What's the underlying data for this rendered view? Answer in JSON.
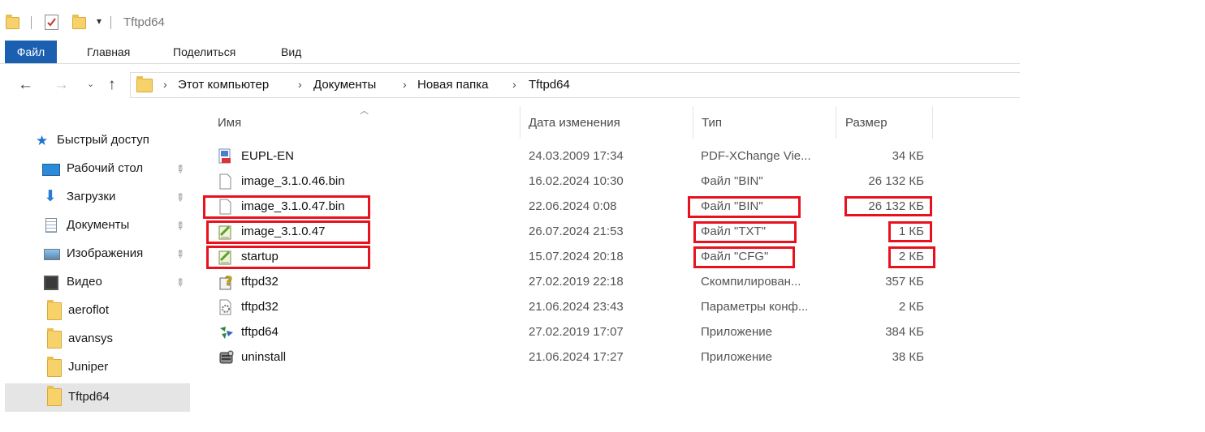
{
  "window": {
    "title": "Tftpd64"
  },
  "ribbon": {
    "tabs": [
      "Файл",
      "Главная",
      "Поделиться",
      "Вид"
    ]
  },
  "address": {
    "crumbs": [
      "Этот компьютер",
      "Документы",
      "Новая папка",
      "Tftpd64"
    ]
  },
  "sidebar": {
    "items": [
      {
        "label": "Быстрый доступ",
        "icon": "star-icon",
        "pinned": false
      },
      {
        "label": "Рабочий стол",
        "icon": "desktop-icon",
        "pinned": true
      },
      {
        "label": "Загрузки",
        "icon": "download-icon",
        "pinned": true
      },
      {
        "label": "Документы",
        "icon": "documents-icon",
        "pinned": true
      },
      {
        "label": "Изображения",
        "icon": "pictures-icon",
        "pinned": true
      },
      {
        "label": "Видео",
        "icon": "video-icon",
        "pinned": true
      },
      {
        "label": "aeroflot",
        "icon": "folder-icon",
        "pinned": false
      },
      {
        "label": "avansys",
        "icon": "folder-icon",
        "pinned": false
      },
      {
        "label": "Juniper",
        "icon": "folder-icon",
        "pinned": false
      },
      {
        "label": "Tftpd64",
        "icon": "folder-icon",
        "pinned": false,
        "selected": true
      }
    ]
  },
  "columns": {
    "name": "Имя",
    "date": "Дата изменения",
    "type": "Тип",
    "size": "Размер"
  },
  "files": [
    {
      "name": "EUPL-EN",
      "date": "24.03.2009 17:34",
      "type": "PDF-XChange Vie...",
      "size": "34 КБ",
      "icon": "pdf-icon"
    },
    {
      "name": "image_3.1.0.46.bin",
      "date": "16.02.2024 10:30",
      "type": "Файл \"BIN\"",
      "size": "26 132 КБ",
      "icon": "blank-file-icon"
    },
    {
      "name": "image_3.1.0.47.bin",
      "date": "22.06.2024 0:08",
      "type": "Файл \"BIN\"",
      "size": "26 132 КБ",
      "icon": "blank-file-icon"
    },
    {
      "name": "image_3.1.0.47",
      "date": "26.07.2024 21:53",
      "type": "Файл \"TXT\"",
      "size": "1 КБ",
      "icon": "text-file-icon"
    },
    {
      "name": "startup",
      "date": "15.07.2024 20:18",
      "type": "Файл \"CFG\"",
      "size": "2 КБ",
      "icon": "text-file-icon"
    },
    {
      "name": "tftpd32",
      "date": "27.02.2019 22:18",
      "type": "Скомпилирован...",
      "size": "357 КБ",
      "icon": "help-file-icon"
    },
    {
      "name": "tftpd32",
      "date": "21.06.2024 23:43",
      "type": "Параметры конф...",
      "size": "2 КБ",
      "icon": "settings-file-icon"
    },
    {
      "name": "tftpd64",
      "date": "27.02.2019 17:07",
      "type": "Приложение",
      "size": "384 КБ",
      "icon": "app-icon"
    },
    {
      "name": "uninstall",
      "date": "21.06.2024 17:27",
      "type": "Приложение",
      "size": "38 КБ",
      "icon": "uninstall-icon"
    }
  ],
  "colors": {
    "file_tab": "#1a5fb0",
    "highlight": "#e8121e",
    "folder": "#f7d26b",
    "selected_bg": "#e5e5e5"
  }
}
